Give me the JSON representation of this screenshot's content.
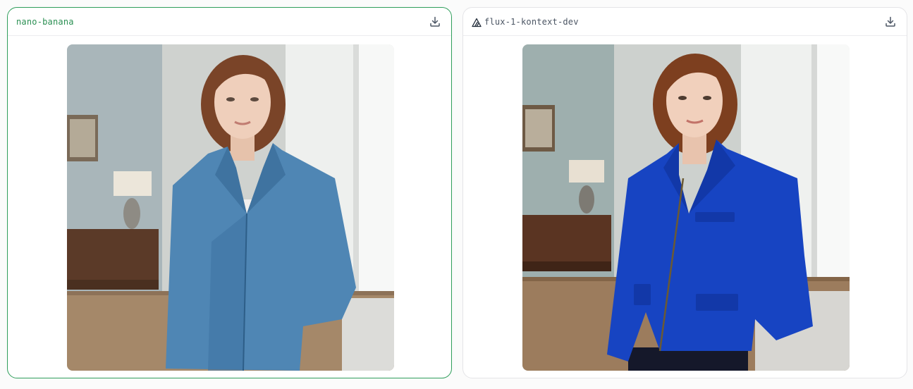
{
  "panels": [
    {
      "model_name": "nano-banana",
      "selected": true,
      "image_alt": "Woman with short auburn bob wearing a blue zip-up knit jacket over a white top, standing in a bright room",
      "jacket_color": "#4f86b4"
    },
    {
      "model_name": "flux-1-kontext-dev",
      "selected": false,
      "image_alt": "Woman with short auburn bob wearing a royal blue zip-up jacket, standing in a bright room",
      "jacket_color": "#1744c2"
    }
  ],
  "icons": {
    "download": "download-icon",
    "provider": "triangle-logo-icon"
  },
  "colors": {
    "accent_selected": "#2f9e5b",
    "border": "#e4e4e7"
  }
}
